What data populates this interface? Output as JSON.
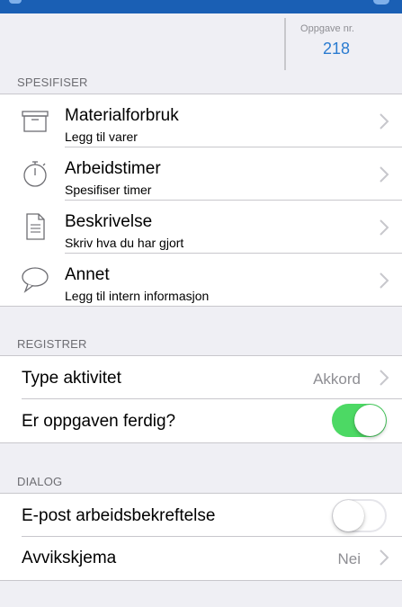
{
  "header": {
    "task_label": "Oppgave nr.",
    "task_number": "218"
  },
  "sections": {
    "specify": "SPESIFISER",
    "register": "REGISTRER",
    "dialog": "DIALOG"
  },
  "specify_items": [
    {
      "title": "Materialforbruk",
      "subtitle": "Legg til varer",
      "icon": "archive-box-icon"
    },
    {
      "title": "Arbeidstimer",
      "subtitle": "Spesifiser timer",
      "icon": "stopwatch-icon"
    },
    {
      "title": "Beskrivelse",
      "subtitle": "Skriv hva du har gjort",
      "icon": "document-icon"
    },
    {
      "title": "Annet",
      "subtitle": "Legg til intern informasjon",
      "icon": "speech-bubble-icon"
    }
  ],
  "register": {
    "activity_type_label": "Type aktivitet",
    "activity_type_value": "Akkord",
    "task_done_label": "Er oppgaven ferdig?",
    "task_done": true
  },
  "dialog": {
    "email_confirm_label": "E-post arbeidsbekreftelse",
    "email_confirm": false,
    "deviation_label": "Avvikskjema",
    "deviation_value": "Nei"
  },
  "colors": {
    "background": "#efeff4",
    "accent": "#2a7bd0",
    "toggle_on": "#4cd964",
    "top_bar": "#1a5fb4"
  }
}
